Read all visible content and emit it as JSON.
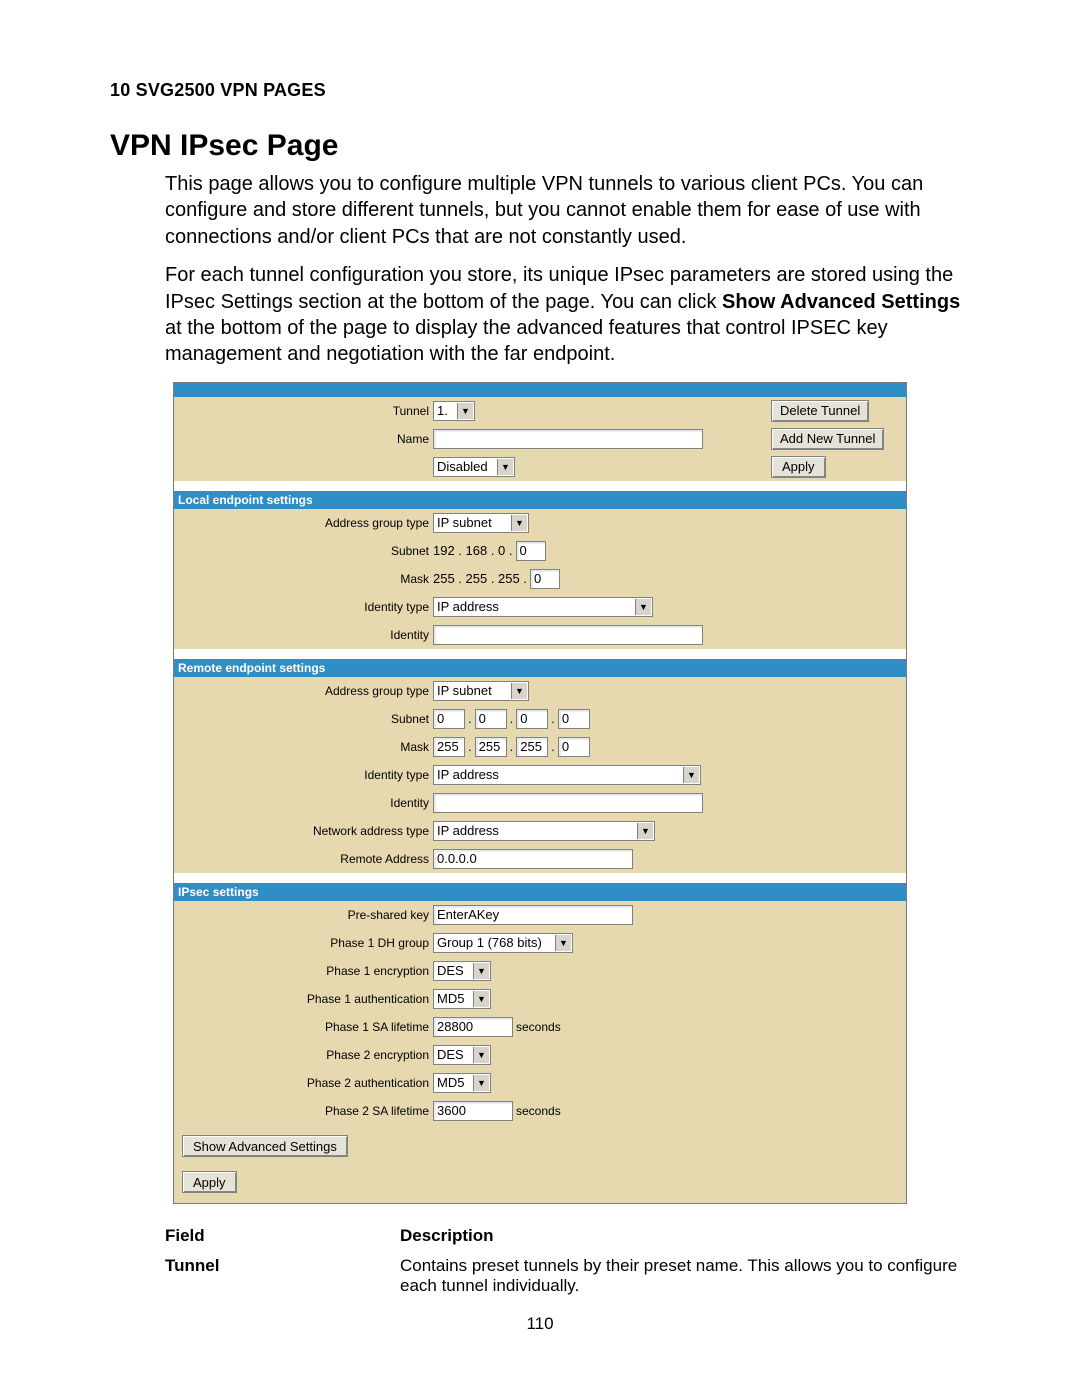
{
  "header": {
    "section": "10 SVG2500 VPN PAGES"
  },
  "title": "VPN IPsec Page",
  "paragraphs": {
    "p1": "This page allows you to configure multiple VPN tunnels to various client PCs. You can configure and store different tunnels, but you cannot enable them for ease of use with connections and/or client PCs that are not constantly used.",
    "p2a": "For each tunnel configuration you store, its unique IPsec parameters are stored using the IPsec Settings section at the bottom of the page. You can click ",
    "p2b_bold": "Show Advanced Settings",
    "p2c": " at the bottom of the page to display the advanced features that control IPSEC key management and negotiation with the far endpoint."
  },
  "form": {
    "tunnel": {
      "label": "Tunnel",
      "value": "1.",
      "delete_btn": "Delete Tunnel"
    },
    "name": {
      "label": "Name",
      "value": "",
      "add_btn": "Add New Tunnel"
    },
    "enable": {
      "value": "Disabled",
      "apply_btn": "Apply"
    },
    "local_title": "Local endpoint settings",
    "local": {
      "addr_group": {
        "label": "Address group type",
        "value": "IP subnet"
      },
      "subnet": {
        "label": "Subnet",
        "prefix": "192 . 168 . 0 .",
        "last": "0"
      },
      "mask": {
        "label": "Mask",
        "prefix": "255 . 255 . 255 .",
        "last": "0"
      },
      "id_type": {
        "label": "Identity type",
        "value": "IP address"
      },
      "identity": {
        "label": "Identity",
        "value": ""
      }
    },
    "remote_title": "Remote endpoint settings",
    "remote": {
      "addr_group": {
        "label": "Address group type",
        "value": "IP subnet"
      },
      "subnet": {
        "label": "Subnet",
        "o1": "0",
        "o2": "0",
        "o3": "0",
        "o4": "0"
      },
      "mask": {
        "label": "Mask",
        "o1": "255",
        "o2": "255",
        "o3": "255",
        "o4": "0"
      },
      "id_type": {
        "label": "Identity type",
        "value": "IP address"
      },
      "identity": {
        "label": "Identity",
        "value": ""
      },
      "net_addr_type": {
        "label": "Network address type",
        "value": "IP address"
      },
      "remote_addr": {
        "label": "Remote Address",
        "value": "0.0.0.0"
      }
    },
    "ipsec_title": "IPsec settings",
    "ipsec": {
      "psk": {
        "label": "Pre-shared key",
        "value": "EnterAKey"
      },
      "p1_dh": {
        "label": "Phase 1 DH group",
        "value": "Group 1 (768 bits)"
      },
      "p1_enc": {
        "label": "Phase 1 encryption",
        "value": "DES"
      },
      "p1_auth": {
        "label": "Phase 1 authentication",
        "value": "MD5"
      },
      "p1_life": {
        "label": "Phase 1 SA lifetime",
        "value": "28800",
        "unit": "seconds"
      },
      "p2_enc": {
        "label": "Phase 2 encryption",
        "value": "DES"
      },
      "p2_auth": {
        "label": "Phase 2 authentication",
        "value": "MD5"
      },
      "p2_life": {
        "label": "Phase 2 SA lifetime",
        "value": "3600",
        "unit": "seconds"
      }
    },
    "show_adv_btn": "Show Advanced Settings",
    "apply_btn": "Apply"
  },
  "desc_table": {
    "head_field": "Field",
    "head_desc": "Description",
    "row1_field": "Tunnel",
    "row1_desc": "Contains preset tunnels by their preset name. This allows you to configure each tunnel individually."
  },
  "page_number": "110"
}
